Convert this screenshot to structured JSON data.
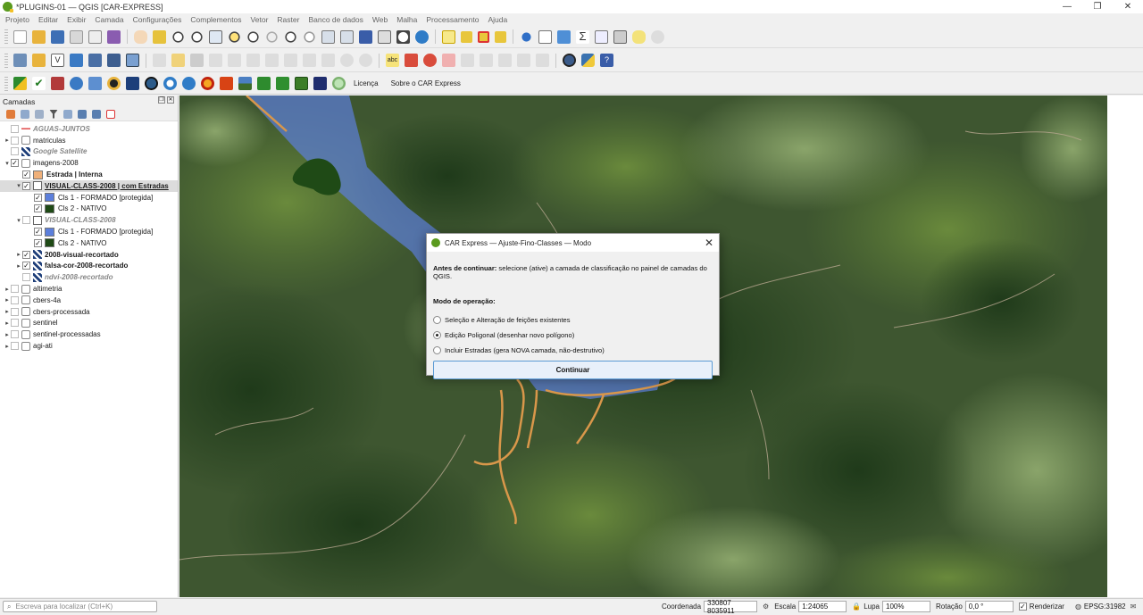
{
  "window": {
    "title": "*PLUGINS-01 — QGIS [CAR-EXPRESS]",
    "controls": [
      "—",
      "❐",
      "✕"
    ]
  },
  "menu": [
    "Projeto",
    "Editar",
    "Exibir",
    "Camada",
    "Configurações",
    "Complementos",
    "Vetor",
    "Raster",
    "Banco de dados",
    "Web",
    "Malha",
    "Processamento",
    "Ajuda"
  ],
  "toolbar3": {
    "license_label": "Licença",
    "about_label": "Sobre o CAR Express"
  },
  "layers_panel": {
    "title": "Camadas",
    "layers": [
      {
        "label": "AGUAS-JUNTOS",
        "style": "italic-grey",
        "indent": 0,
        "arrow": "",
        "checked": false,
        "icon": "line-red"
      },
      {
        "label": "matriculas",
        "style": "normal",
        "indent": 0,
        "arrow": "▸",
        "checked": false,
        "icon": "group"
      },
      {
        "label": "Google Satellite",
        "style": "italic-grey",
        "indent": 0,
        "arrow": "",
        "checked": false,
        "icon": "raster"
      },
      {
        "label": "imagens-2008",
        "style": "normal",
        "indent": 0,
        "arrow": "▾",
        "checked": true,
        "icon": "group"
      },
      {
        "label": "Estrada | Interna",
        "style": "bold",
        "indent": 1,
        "arrow": "",
        "checked": true,
        "icon": "swatch-orange"
      },
      {
        "label": "VISUAL-CLASS-2008 | com Estradas",
        "style": "bold-underline",
        "indent": 1,
        "arrow": "▾",
        "checked": true,
        "icon": "polygon",
        "selected": true
      },
      {
        "label": "Cls 1 - FORMADO [protegida]",
        "style": "normal",
        "indent": 2,
        "arrow": "",
        "checked": true,
        "icon": "swatch-blue"
      },
      {
        "label": "Cls 2 - NATIVO",
        "style": "normal",
        "indent": 2,
        "arrow": "",
        "checked": true,
        "icon": "swatch-green"
      },
      {
        "label": "VISUAL-CLASS-2008",
        "style": "italic-grey",
        "indent": 1,
        "arrow": "▾",
        "checked": false,
        "icon": "polygon"
      },
      {
        "label": "Cls 1 - FORMADO [protegida]",
        "style": "normal",
        "indent": 2,
        "arrow": "",
        "checked": true,
        "icon": "swatch-blue"
      },
      {
        "label": "Cls 2 - NATIVO",
        "style": "normal",
        "indent": 2,
        "arrow": "",
        "checked": true,
        "icon": "swatch-green"
      },
      {
        "label": "2008-visual-recortado",
        "style": "bold",
        "indent": 1,
        "arrow": "▸",
        "checked": true,
        "icon": "raster"
      },
      {
        "label": "falsa-cor-2008-recortado",
        "style": "bold",
        "indent": 1,
        "arrow": "▸",
        "checked": true,
        "icon": "raster"
      },
      {
        "label": "ndvi-2008-recortado",
        "style": "italic-grey",
        "indent": 1,
        "arrow": "",
        "checked": false,
        "icon": "raster"
      },
      {
        "label": "altimetria",
        "style": "normal",
        "indent": 0,
        "arrow": "▸",
        "checked": false,
        "icon": "group"
      },
      {
        "label": "cbers-4a",
        "style": "normal",
        "indent": 0,
        "arrow": "▸",
        "checked": false,
        "icon": "group"
      },
      {
        "label": "cbers-processada",
        "style": "normal",
        "indent": 0,
        "arrow": "▸",
        "checked": false,
        "icon": "group"
      },
      {
        "label": "sentinel",
        "style": "normal",
        "indent": 0,
        "arrow": "▸",
        "checked": false,
        "icon": "group"
      },
      {
        "label": "sentinel-processadas",
        "style": "normal",
        "indent": 0,
        "arrow": "▸",
        "checked": false,
        "icon": "group"
      },
      {
        "label": "agi-ati",
        "style": "normal",
        "indent": 0,
        "arrow": "▸",
        "checked": false,
        "icon": "group"
      }
    ]
  },
  "dialog": {
    "title": "CAR Express — Ajuste-Fino-Classes — Modo",
    "instruction_bold": "Antes de continuar:",
    "instruction_rest": " selecione (ative) a camada de classificação no painel de camadas do QGIS.",
    "mode_heading": "Modo de operação:",
    "options": [
      {
        "label": "Seleção e Alteração de feições existentes",
        "selected": false
      },
      {
        "label": "Edição Poligonal (desenhar novo polígono)",
        "selected": true
      },
      {
        "label": "Incluir Estradas (gera NOVA camada, não-destrutivo)",
        "selected": false
      }
    ],
    "continue_label": "Continuar"
  },
  "statusbar": {
    "locator_placeholder": "Escreva para localizar (Ctrl+K)",
    "coord_label": "Coordenada",
    "coord_value": "330807  8035911",
    "scale_label": "Escala",
    "scale_value": "1:24065",
    "magnifier_label": "Lupa",
    "magnifier_value": "100%",
    "rotation_label": "Rotação",
    "rotation_value": "0,0 °",
    "render_label": "Renderizar",
    "crs_label": "EPSG:31982"
  },
  "colors": {
    "class1": "#5c7fdc",
    "class2": "#1f4a16",
    "road": "#d9974a",
    "accent": "#5b9bd5"
  }
}
